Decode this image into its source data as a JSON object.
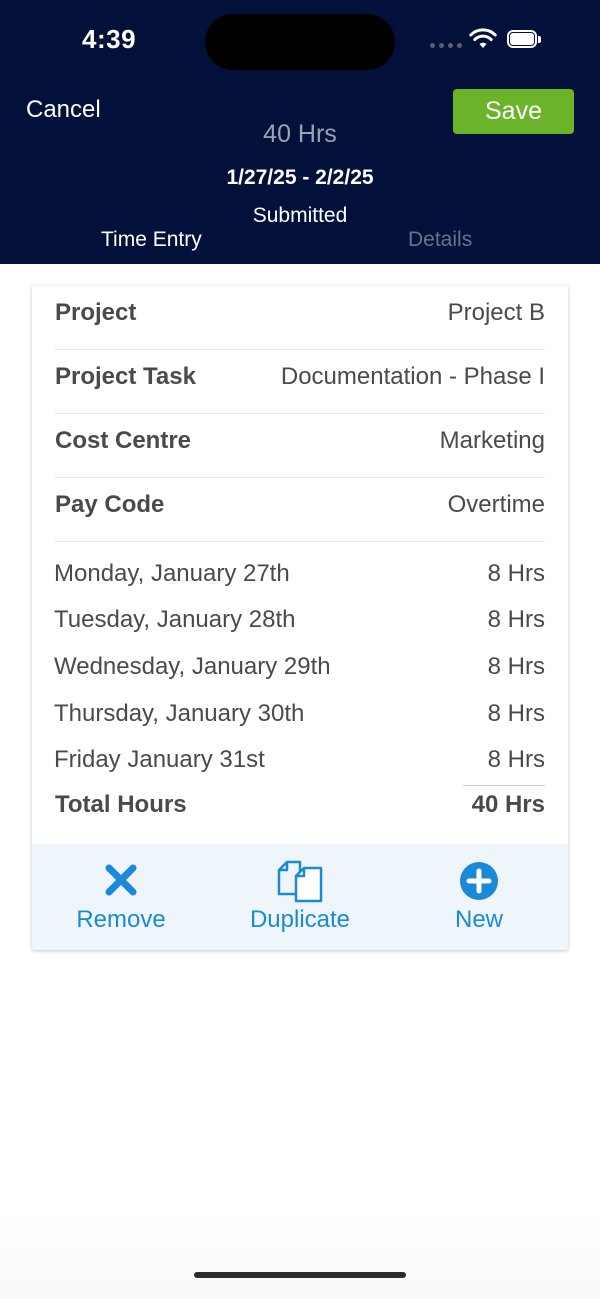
{
  "status_bar": {
    "time": "4:39"
  },
  "header": {
    "cancel_label": "Cancel",
    "save_label": "Save",
    "total_hours": "40 Hrs",
    "date_range": "1/27/25 - 2/2/25",
    "status": "Submitted",
    "tabs": [
      {
        "label": "Time Entry",
        "active": true
      },
      {
        "label": "Details",
        "active": false
      }
    ]
  },
  "entry": {
    "fields": [
      {
        "label": "Project",
        "value": "Project B"
      },
      {
        "label": "Project Task",
        "value": "Documentation - Phase I"
      },
      {
        "label": "Cost Centre",
        "value": "Marketing"
      },
      {
        "label": "Pay Code",
        "value": "Overtime"
      }
    ],
    "days": [
      {
        "label": "Monday, January 27th",
        "hours": "8 Hrs"
      },
      {
        "label": "Tuesday, January 28th",
        "hours": "8 Hrs"
      },
      {
        "label": "Wednesday, January 29th",
        "hours": "8 Hrs"
      },
      {
        "label": "Thursday, January 30th",
        "hours": "8 Hrs"
      },
      {
        "label": "Friday January 31st",
        "hours": "8 Hrs"
      }
    ],
    "total_label": "Total Hours",
    "total_value": "40 Hrs"
  },
  "actions": [
    {
      "label": "Remove",
      "icon": "close-icon"
    },
    {
      "label": "Duplicate",
      "icon": "duplicate-icon"
    },
    {
      "label": "New",
      "icon": "plus-circle-icon"
    }
  ],
  "colors": {
    "header_bg": "#03113a",
    "save_green": "#6bb42a",
    "accent_blue": "#1a8ad6",
    "action_bar_bg": "#eef6fc"
  }
}
